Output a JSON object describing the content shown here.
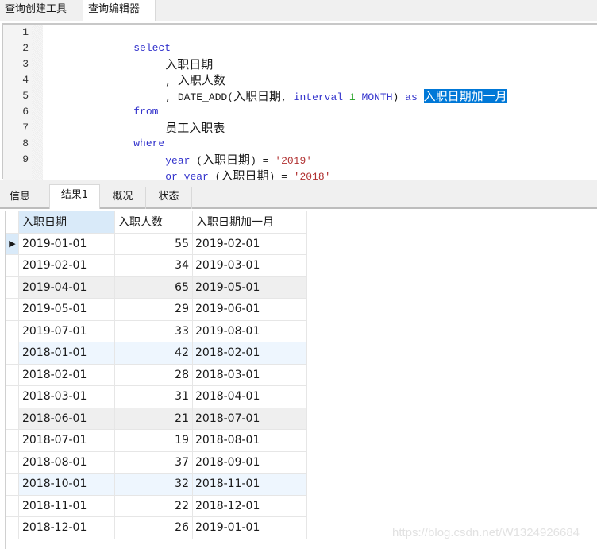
{
  "top_tabs": [
    {
      "label": "查询创建工具",
      "active": false
    },
    {
      "label": "查询编辑器",
      "active": true
    }
  ],
  "editor": {
    "line_numbers": [
      "1",
      "2",
      "3",
      "4",
      "5",
      "6",
      "7",
      "8",
      "9"
    ],
    "lines": {
      "l1_kw": "select",
      "l2_text": "入职日期",
      "l3_prefix": ", ",
      "l3_text": "入职人数",
      "l4_prefix": ", DATE_ADD(",
      "l4_field": "入职日期",
      "l4_comma": ", ",
      "l4_interval": "interval",
      "l4_num": "1",
      "l4_unit": "MONTH",
      "l4_close": ")",
      "l4_as": "as",
      "l4_alias": "入职日期加一月",
      "l5_kw": "from",
      "l6_text": "员工入职表",
      "l7_kw": "where",
      "l8_fn": "year",
      "l8_open": " (",
      "l8_field": "入职日期",
      "l8_close": ") = ",
      "l8_str": "'2019'",
      "l9_or": "or",
      "l9_fn": "year",
      "l9_open": " (",
      "l9_field": "入职日期",
      "l9_close": ") = ",
      "l9_str": "'2018'"
    },
    "selected_text": "入职日期加一月"
  },
  "result_tabs": [
    {
      "label": "信息",
      "active": false
    },
    {
      "label": "结果1",
      "active": true
    },
    {
      "label": "概况",
      "active": false
    },
    {
      "label": "状态",
      "active": false
    }
  ],
  "grid": {
    "columns": [
      "入职日期",
      "入职人数",
      "入职日期加一月"
    ],
    "current_row_marker": "▶",
    "rows": [
      {
        "date": "2019-01-01",
        "count": "55",
        "plus_month": "2019-02-01",
        "style": "current"
      },
      {
        "date": "2019-02-01",
        "count": "34",
        "plus_month": "2019-03-01",
        "style": ""
      },
      {
        "date": "2019-04-01",
        "count": "65",
        "plus_month": "2019-05-01",
        "style": "alt-gray"
      },
      {
        "date": "2019-05-01",
        "count": "29",
        "plus_month": "2019-06-01",
        "style": ""
      },
      {
        "date": "2019-07-01",
        "count": "33",
        "plus_month": "2019-08-01",
        "style": ""
      },
      {
        "date": "2018-01-01",
        "count": "42",
        "plus_month": "2018-02-01",
        "style": "alt-blue"
      },
      {
        "date": "2018-02-01",
        "count": "28",
        "plus_month": "2018-03-01",
        "style": ""
      },
      {
        "date": "2018-03-01",
        "count": "31",
        "plus_month": "2018-04-01",
        "style": ""
      },
      {
        "date": "2018-06-01",
        "count": "21",
        "plus_month": "2018-07-01",
        "style": "alt-gray"
      },
      {
        "date": "2018-07-01",
        "count": "19",
        "plus_month": "2018-08-01",
        "style": ""
      },
      {
        "date": "2018-08-01",
        "count": "37",
        "plus_month": "2018-09-01",
        "style": ""
      },
      {
        "date": "2018-10-01",
        "count": "32",
        "plus_month": "2018-11-01",
        "style": "alt-blue"
      },
      {
        "date": "2018-11-01",
        "count": "22",
        "plus_month": "2018-12-01",
        "style": ""
      },
      {
        "date": "2018-12-01",
        "count": "26",
        "plus_month": "2019-01-01",
        "style": ""
      }
    ]
  },
  "watermark": "https://blog.csdn.net/W1324926684",
  "colors": {
    "keyword": "#3333cc",
    "number": "#20a020",
    "string": "#b03030",
    "selection": "#0078d7",
    "header_highlight": "#d9eaf9"
  }
}
